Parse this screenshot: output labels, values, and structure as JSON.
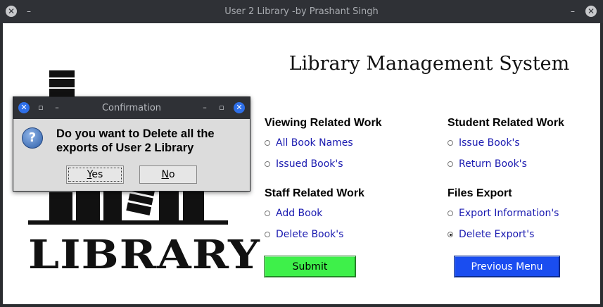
{
  "window": {
    "title": "User 2 Library -by Prashant Singh"
  },
  "app": {
    "title": "Library Management System",
    "logo_text": "LIBRARY"
  },
  "sections": {
    "viewing": {
      "heading": "Viewing Related Work",
      "options": [
        "All Book Names",
        "Issued Book's"
      ]
    },
    "student": {
      "heading": "Student Related Work",
      "options": [
        "Issue Book's",
        "Return Book's"
      ]
    },
    "staff": {
      "heading": "Staff Related Work",
      "options": [
        "Add Book",
        "Delete Book's"
      ]
    },
    "files": {
      "heading": "Files Export",
      "options": [
        "Export Information's",
        "Delete Export's"
      ],
      "selected": "Delete Export's"
    }
  },
  "buttons": {
    "submit": "Submit",
    "previous_menu": "Previous Menu"
  },
  "colors": {
    "submit_bg": "#3ef04a",
    "previous_bg": "#1a4df0",
    "option_text": "#1a1ab0"
  },
  "dialog": {
    "title": "Confirmation",
    "message": "Do you want to Delete all the exports of User 2 Library",
    "yes": "Yes",
    "no": "No",
    "icon": "question-icon"
  }
}
